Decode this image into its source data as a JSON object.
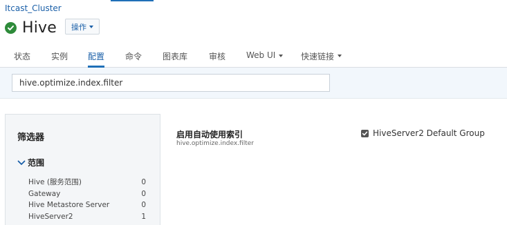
{
  "header": {
    "cluster_name": "Itcast_Cluster",
    "service_name": "Hive",
    "actions_label": "操作"
  },
  "tabs": [
    {
      "label": "状态"
    },
    {
      "label": "实例"
    },
    {
      "label": "配置"
    },
    {
      "label": "命令"
    },
    {
      "label": "图表库"
    },
    {
      "label": "审核"
    },
    {
      "label": "Web UI"
    },
    {
      "label": "快速链接"
    }
  ],
  "active_tab": "配置",
  "search": {
    "value": "hive.optimize.index.filter"
  },
  "filters": {
    "title": "筛选器",
    "scope_label": "范围",
    "items": [
      {
        "label": "Hive (服务范围)",
        "count": "0"
      },
      {
        "label": "Gateway",
        "count": "0"
      },
      {
        "label": "Hive Metastore Server",
        "count": "0"
      },
      {
        "label": "HiveServer2",
        "count": "1"
      }
    ]
  },
  "property": {
    "display_name": "启用自动使用索引",
    "key": "hive.optimize.index.filter",
    "group_label": "HiveServer2 Default Group",
    "group_checked": true
  },
  "colors": {
    "accent": "#1f6fb8",
    "link": "#1a5fa8",
    "status_ok": "#2e8b3a",
    "search_band": "#f2f7fc"
  }
}
